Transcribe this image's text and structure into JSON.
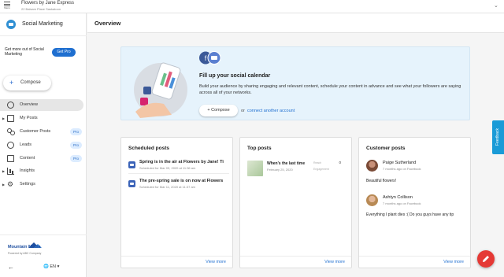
{
  "topbar": {
    "menu_label": "Menu",
    "business_name": "Flowers by Jane Express",
    "business_address": "22 Balsam Place Saskatoon"
  },
  "sidebar": {
    "title": "Social Marketing",
    "promo_text": "Get more out of Social Marketing",
    "get_pro": "Get Pro",
    "compose": "Compose",
    "items": [
      {
        "label": "Overview"
      },
      {
        "label": "My Posts"
      },
      {
        "label": "Customer Posts",
        "badge": "Pro"
      },
      {
        "label": "Leads",
        "badge": "Pro"
      },
      {
        "label": "Content",
        "badge": "Pro"
      },
      {
        "label": "Insights"
      },
      {
        "label": "Settings"
      }
    ],
    "brand_name": "Mountain Media",
    "brand_sub": "Powered by ABC Company",
    "language": "EN"
  },
  "main": {
    "title": "Overview",
    "hero": {
      "title": "Fill up your social calendar",
      "description": "Build your audience by sharing engaging and relevant content, schedule your content in advance and see what your followers are saying across all of your networks.",
      "compose": "Compose",
      "or": "or",
      "connect": "connect another account"
    },
    "scheduled": {
      "title": "Scheduled posts",
      "items": [
        {
          "text": "Spring is in the air at Flowers by Jane! Ti",
          "date": "Scheduled for Mar 09, 2020 at 11:36 am"
        },
        {
          "text": "The pre-spring sale is on now at Flowers",
          "date": "Scheduled for Mar 11, 2020 at 11:37 am"
        }
      ],
      "view_more": "View more"
    },
    "top_posts": {
      "title": "Top posts",
      "item": {
        "text": "When's the last time",
        "date": "February 25, 2020",
        "stat1_label": "Reach",
        "stat1_value": "0",
        "stat2_label": "Engagement"
      },
      "view_more": "View more"
    },
    "customer_posts": {
      "title": "Customer posts",
      "items": [
        {
          "name": "Paige Sutherland",
          "meta": "7 months ago on Facebook",
          "body": "Beautiful flowers!"
        },
        {
          "name": "Ashtyn Collison",
          "meta": "7 months ago on Facebook",
          "body": "Everything I plant dies :( Do you guys have any tip"
        }
      ],
      "view_more": "View more"
    }
  },
  "feedback": "Feedback",
  "colors": {
    "accent": "#1f6fd0",
    "fab": "#e53935",
    "hero_bg": "#e6f3fc",
    "feedback": "#1a9bd7"
  }
}
